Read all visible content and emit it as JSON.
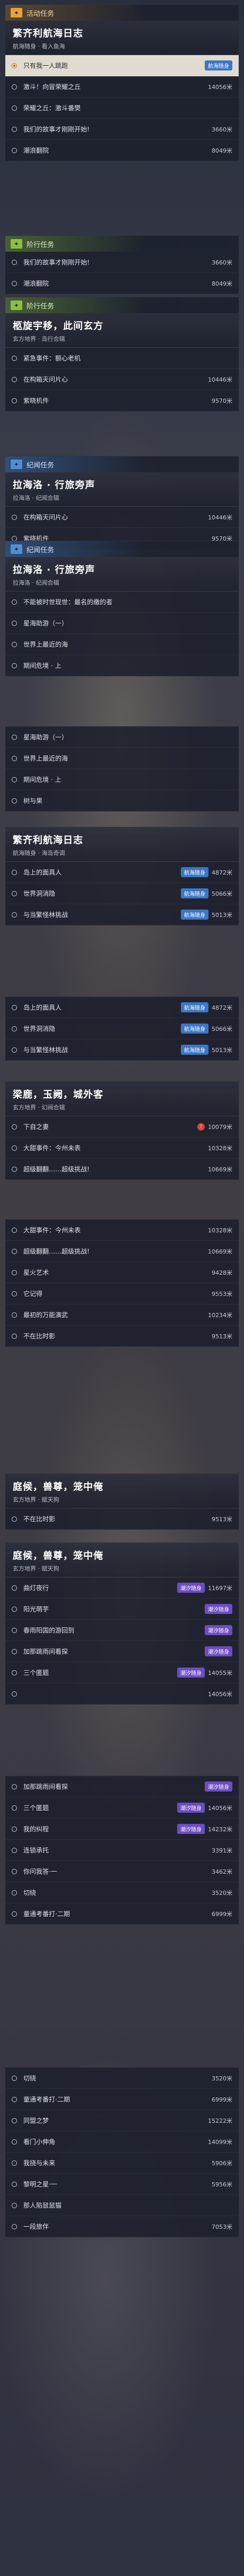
{
  "s1": {
    "head": "活动任务",
    "title": "繁齐利航海日志",
    "subtitle": "航海随身 · 看入鱼海",
    "rows": [
      {
        "label": "只有我一人跳跑",
        "dist": "",
        "badge": "航海随身",
        "selected": true
      },
      {
        "label": "激斗！向冒荣耀之丘",
        "dist": "14056米",
        "badge": ""
      },
      {
        "label": "荣耀之丘：激斗番樊",
        "dist": "",
        "badge": ""
      },
      {
        "label": "我们的故事才刚刚开始!",
        "dist": "3660米",
        "badge": ""
      },
      {
        "label": "潮浪翻院",
        "dist": "8049米",
        "badge": ""
      }
    ]
  },
  "s2": {
    "head": "阶行任务",
    "rows": [
      {
        "label": "我们的故事才刚刚开始!",
        "dist": "3660米"
      },
      {
        "label": "潮浪翻院",
        "dist": "8049米"
      }
    ]
  },
  "s3": {
    "head": "阶行任务",
    "title": "柩旋宇移，此间玄方",
    "subtitle": "玄方地界 · 岛行合辑",
    "rows": [
      {
        "label": "紧急事件：额心老机",
        "dist": ""
      },
      {
        "label": "在构箱天问片心",
        "dist": "10446米"
      },
      {
        "label": "紫晓机件",
        "dist": "9570米"
      }
    ]
  },
  "s4": {
    "head": "纪闻任务",
    "title": "拉海洛 · 行旅旁声",
    "subtitle": "拉海洛 · 纪闻合辑",
    "rows": [
      {
        "label": "在构箱天问片心",
        "dist": "10446米"
      },
      {
        "label": "紫晓机件",
        "dist": "9570米"
      }
    ]
  },
  "s5": {
    "head": "纪闻任务",
    "title": "拉海洛 · 行旅旁声",
    "subtitle": "拉海洛 · 纪闻合辑",
    "rows": [
      {
        "label": "不能被时世现世：最名的缴的者",
        "dist": ""
      },
      {
        "label": "星海助游（一）",
        "dist": ""
      },
      {
        "label": "世界上最近的海",
        "dist": ""
      },
      {
        "label": "期间危境 · 上",
        "dist": ""
      }
    ]
  },
  "s6": {
    "rows": [
      {
        "label": "星海助游（一）",
        "dist": ""
      },
      {
        "label": "世界上最近的海",
        "dist": ""
      },
      {
        "label": "期间危境 · 上",
        "dist": ""
      },
      {
        "label": "树与果",
        "dist": ""
      }
    ]
  },
  "s7": {
    "title": "繁齐利航海日志",
    "subtitle": "航海随身 · 海岛奇调",
    "rows": [
      {
        "label": "岛上的面具人",
        "dist": "4872米",
        "badge": "航海随身"
      },
      {
        "label": "世界洞消隐",
        "dist": "5066米",
        "badge": "航海随身"
      },
      {
        "label": "与当繁怪林挑战",
        "dist": "5013米",
        "badge": "航海随身"
      }
    ]
  },
  "s8": {
    "rows": [
      {
        "label": "岛上的面具人",
        "dist": "4872米",
        "badge": "航海随身"
      },
      {
        "label": "世界洞消隐",
        "dist": "5066米",
        "badge": "航海随身"
      },
      {
        "label": "与当繁怪林挑战",
        "dist": "5013米",
        "badge": "航海随身"
      }
    ]
  },
  "s9": {
    "title": "梁鹿，玉阙，城外客",
    "subtitle": "玄方地界 · 幻阀合辑",
    "rows": [
      {
        "label": "下自之妻",
        "dist": "10079米",
        "badge": "!"
      },
      {
        "label": "大甜事件：今州未表",
        "dist": "10328米"
      },
      {
        "label": "超级翻翻……超级挑战!",
        "dist": "10669米"
      }
    ]
  },
  "s10": {
    "rows": [
      {
        "label": "大甜事件：今州未表",
        "dist": "10328米"
      },
      {
        "label": "超级翻翻……超级挑战!",
        "dist": "10669米"
      },
      {
        "label": "星火艺术",
        "dist": "9428米"
      },
      {
        "label": "它记得",
        "dist": "9553米"
      },
      {
        "label": "最初的万能演武",
        "dist": "10234米"
      },
      {
        "label": "不在比时影",
        "dist": "9513米"
      }
    ]
  },
  "s11": {
    "title": "庭候，兽尊，笼中俺",
    "subtitle": "玄方地界 · 赋天狗",
    "rows": [
      {
        "label": "不在比时影",
        "dist": "9513米"
      }
    ]
  },
  "s12": {
    "title": "庭候，兽尊，笼中俺",
    "subtitle": "玄方地界 · 赋天狗",
    "rows": [
      {
        "label": "曲灯夜行",
        "dist": "11697米",
        "badge": "潮汐随身"
      },
      {
        "label": "阳光萌芋",
        "dist": "",
        "badge": "潮汐随身"
      },
      {
        "label": "春雨阳国的游回到",
        "dist": "",
        "badge": "潮汐随身"
      },
      {
        "label": "加那跳雨间看探",
        "dist": "",
        "badge": "潮汐随身"
      },
      {
        "label": "三个匿题",
        "dist": "14055米",
        "badge": "潮汐随身"
      },
      {
        "label": "",
        "dist": "14056米",
        "badge": ""
      }
    ]
  },
  "s13": {
    "rows": [
      {
        "label": "加那跳雨间看探",
        "dist": "",
        "badge": "潮汐随身"
      },
      {
        "label": "三个匿题",
        "dist": "14056米",
        "badge": "潮汐随身"
      },
      {
        "label": "我的纠程",
        "dist": "14232米",
        "badge": "潮汐随身"
      },
      {
        "label": "连锁承托",
        "dist": "3391米"
      },
      {
        "label": "你问我答·一",
        "dist": "3462米"
      },
      {
        "label": "切绕",
        "dist": "3520米"
      },
      {
        "label": "童通考番打·二期",
        "dist": "6999米"
      }
    ]
  },
  "s14": {
    "rows": [
      {
        "label": "切绕",
        "dist": "3520米"
      },
      {
        "label": "童通考番打·二期",
        "dist": "6999米"
      },
      {
        "label": "同盟之梦",
        "dist": "15222米"
      },
      {
        "label": "看门小伸角",
        "dist": "14099米"
      },
      {
        "label": "我挠与未来",
        "dist": "5906米"
      },
      {
        "label": "黎明之星·一",
        "dist": "5956米"
      },
      {
        "label": "那人陷鼠鼠猫",
        "dist": ""
      },
      {
        "label": "一段旅伴",
        "dist": "7053米"
      }
    ]
  }
}
